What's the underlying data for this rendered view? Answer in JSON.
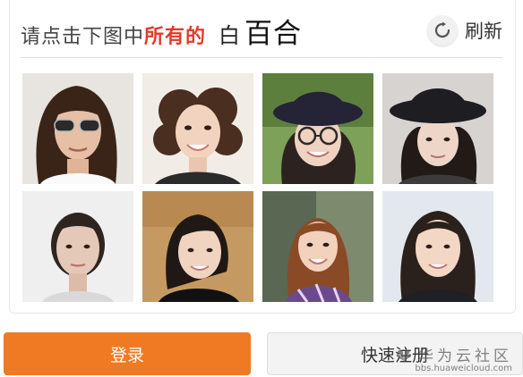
{
  "captcha": {
    "prompt": {
      "lead": "请点击下图中",
      "highlight": "所有的",
      "target_char": "白",
      "target_word": "百合"
    },
    "refresh": {
      "icon": "refresh-icon",
      "label": "刷新"
    },
    "images": [
      {
        "name": "sunglasses-woman"
      },
      {
        "name": "curly-hair-woman"
      },
      {
        "name": "hat-glasses-woman"
      },
      {
        "name": "black-hat-woman"
      },
      {
        "name": "bun-hair-woman"
      },
      {
        "name": "side-part-woman"
      },
      {
        "name": "smiling-woman"
      },
      {
        "name": "long-hair-woman"
      }
    ]
  },
  "actions": {
    "login_label": "登录",
    "register_label": "快速注册"
  },
  "watermark": {
    "main": "华为云社区",
    "sub": "bbs.huaweicloud.com"
  },
  "colors": {
    "highlight": "#e03b2b",
    "login_button": "#f07a24"
  }
}
